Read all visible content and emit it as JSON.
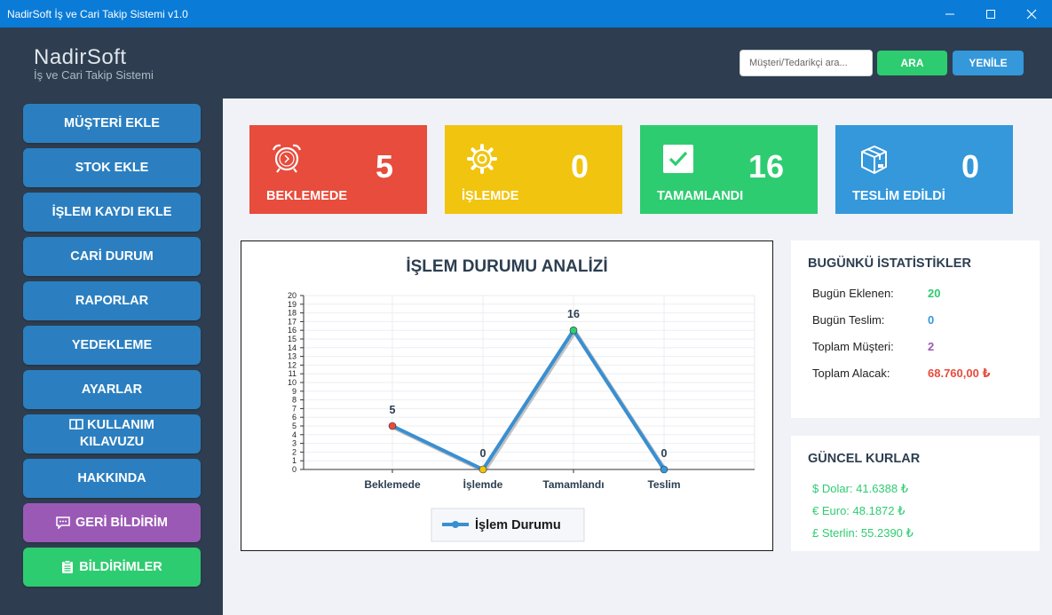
{
  "window": {
    "title": "NadirSoft İş ve Cari Takip Sistemi v1.0"
  },
  "header": {
    "brand_name": "NadirSoft",
    "brand_sub": "İş ve Cari Takip Sistemi",
    "search_placeholder": "Müşteri/Tedarikçi ara...",
    "search_button": "ARA",
    "refresh_button": "YENİLE"
  },
  "sidebar": {
    "items": [
      {
        "label": "MÜŞTERİ EKLE"
      },
      {
        "label": "STOK EKLE"
      },
      {
        "label": "İŞLEM KAYDI EKLE"
      },
      {
        "label": "CARİ DURUM"
      },
      {
        "label": "RAPORLAR"
      },
      {
        "label": "YEDEKLEME"
      },
      {
        "label": "AYARLAR"
      },
      {
        "label": "KULLANIM KILAVUZU",
        "icon": "book-icon"
      },
      {
        "label": "HAKKINDA"
      },
      {
        "label": "GERİ BİLDİRİM",
        "icon": "chat-icon"
      },
      {
        "label": "BİLDİRİMLER",
        "icon": "clipboard-icon"
      }
    ]
  },
  "cards": [
    {
      "label": "BEKLEMEDE",
      "value": "5",
      "icon": "alarm-clock-icon",
      "color": "#e74c3c"
    },
    {
      "label": "İŞLEMDE",
      "value": "0",
      "icon": "gear-icon",
      "color": "#f1c40f"
    },
    {
      "label": "TAMAMLANDI",
      "value": "16",
      "icon": "checkbox-icon",
      "color": "#2ecc71"
    },
    {
      "label": "TESLİM EDİLDİ",
      "value": "0",
      "icon": "box-icon",
      "color": "#3498db"
    }
  ],
  "chart_data": {
    "type": "line",
    "title": "İŞLEM DURUMU ANALİZİ",
    "categories": [
      "Beklemede",
      "İşlemde",
      "Tamamlandı",
      "Teslim"
    ],
    "series": [
      {
        "name": "İşlem Durumu",
        "values": [
          5,
          0,
          16,
          0
        ],
        "color": "#3a8fd0"
      }
    ],
    "point_colors": [
      "#e74c3c",
      "#f1c40f",
      "#2ecc71",
      "#3498db"
    ],
    "data_labels": [
      "5",
      "0",
      "16",
      "0"
    ],
    "y_ticks": [
      "0",
      "1",
      "2",
      "3",
      "4",
      "5",
      "6",
      "7",
      "8",
      "9",
      "10",
      "11",
      "12",
      "13",
      "14",
      "15",
      "16",
      "17",
      "18",
      "19",
      "20"
    ],
    "ylim": [
      0,
      20
    ],
    "grid": true,
    "legend": "bottom"
  },
  "stats": {
    "title": "BUGÜNKÜ İSTATİSTİKLER",
    "rows": [
      {
        "label": "Bugün Eklenen:",
        "value": "20",
        "color": "#2ecc71"
      },
      {
        "label": "Bugün Teslim:",
        "value": "0",
        "color": "#3498db"
      },
      {
        "label": "Toplam Müşteri:",
        "value": "2",
        "color": "#9b59b6"
      },
      {
        "label": "Toplam Alacak:",
        "value": "68.760,00 ₺",
        "color": "#e74c3c"
      }
    ]
  },
  "rates": {
    "title": "GÜNCEL KURLAR",
    "rows": [
      {
        "text": "$ Dolar: 41.6388 ₺"
      },
      {
        "text": "€ Euro: 48.1872 ₺"
      },
      {
        "text": "£ Sterlin: 55.2390 ₺"
      }
    ]
  }
}
